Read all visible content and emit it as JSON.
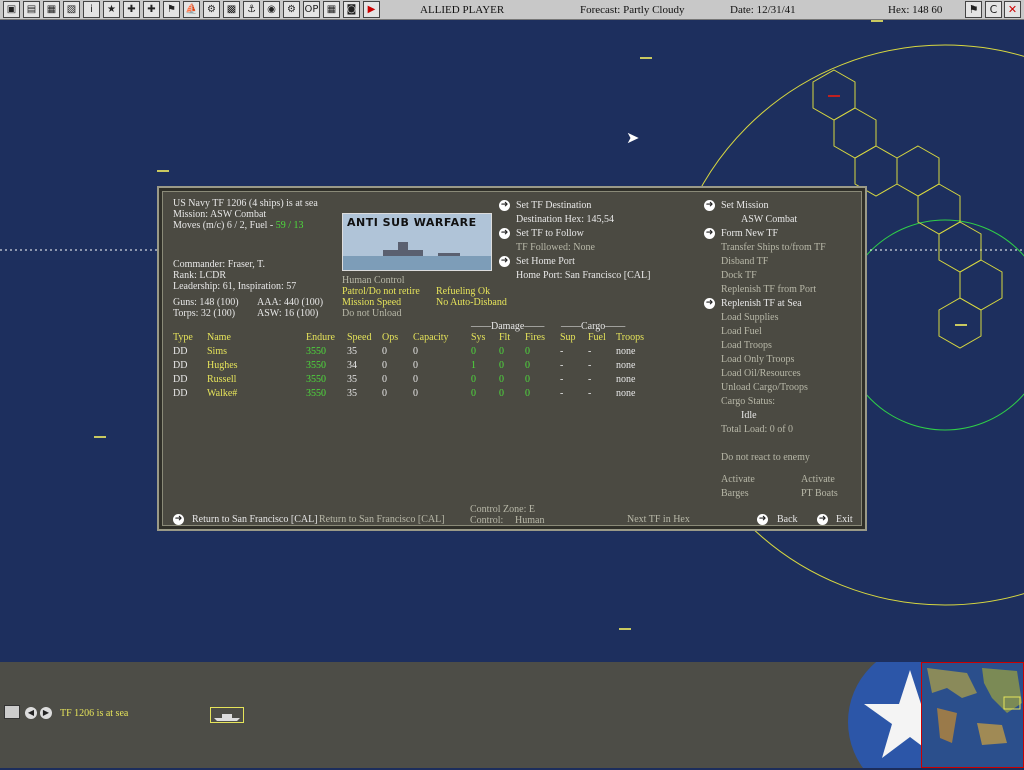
{
  "topbar": {
    "buttons": [
      "▣",
      "▤",
      "▦",
      "▧",
      "i",
      "★",
      "✚",
      "✚",
      "⚑",
      "⛵",
      "⚙",
      "▩",
      "⚓",
      "◉",
      "⚙",
      "OP",
      "▦",
      "◙",
      "▶"
    ],
    "player": "ALLIED PLAYER",
    "forecast": "Forecast: Partly Cloudy",
    "date": "Date: 12/31/41",
    "hex": "Hex: 148 60",
    "right_buttons": [
      "⚑",
      "C",
      "✕"
    ]
  },
  "panel": {
    "header": {
      "line1": "US Navy TF 1206 (4 ships) is at sea",
      "line2": "Mission:  ASW Combat",
      "line3_prefix": "Moves (m/c) 6 / 2, Fuel - ",
      "line3_fuel": "59 / 13"
    },
    "commander": {
      "name": "Commander: Fraser, T.",
      "rank": "Rank: LCDR",
      "leadership": "Leadership: 61, Inspiration: 57"
    },
    "stats": {
      "guns": "Guns: 148 (100)",
      "aaa": "AAA: 440 (100)",
      "torps": "Torps: 32 (100)",
      "asw": "ASW: 16 (100)"
    },
    "badge_title": "ANTI SUB WARFARE",
    "control": {
      "human_control": "Human Control",
      "patrol": "Patrol/Do not retire",
      "mission_speed": "Mission Speed",
      "unload": "Do not Unload",
      "refueling": "Refueling Ok",
      "auto_disband": "No Auto-Disband"
    },
    "destination": {
      "set_dest": "Set TF Destination",
      "dest_hex": "Destination Hex: 145,54",
      "set_follow": "Set TF to Follow",
      "followed": "TF Followed: None",
      "set_home": "Set Home Port",
      "home_port": "Home Port: San Francisco [CAL]"
    },
    "table": {
      "group_damage": "Damage",
      "group_cargo": "Cargo",
      "headers": [
        "Type",
        "Name",
        "Endure",
        "Speed",
        "Ops",
        "Capacity",
        "Sys",
        "Flt",
        "Fires",
        "Sup",
        "Fuel",
        "Troops"
      ],
      "rows": [
        {
          "type": "DD",
          "name": "Sims",
          "endure": "3550",
          "speed": "35",
          "ops": "0",
          "capacity": "0",
          "sys": "0",
          "flt": "0",
          "fires": "0",
          "sup": "-",
          "fuel": "-",
          "troops": "none"
        },
        {
          "type": "DD",
          "name": "Hughes",
          "endure": "3550",
          "speed": "34",
          "ops": "0",
          "capacity": "0",
          "sys": "1",
          "flt": "0",
          "fires": "0",
          "sup": "-",
          "fuel": "-",
          "troops": "none"
        },
        {
          "type": "DD",
          "name": "Russell",
          "endure": "3550",
          "speed": "35",
          "ops": "0",
          "capacity": "0",
          "sys": "0",
          "flt": "0",
          "fires": "0",
          "sup": "-",
          "fuel": "-",
          "troops": "none"
        },
        {
          "type": "DD",
          "name": "Walke#",
          "endure": "3550",
          "speed": "35",
          "ops": "0",
          "capacity": "0",
          "sys": "0",
          "flt": "0",
          "fires": "0",
          "sup": "-",
          "fuel": "-",
          "troops": "none"
        }
      ]
    },
    "menu": {
      "set_mission": "Set Mission",
      "mission_value": "ASW Combat",
      "form_new_tf": "Form New TF",
      "transfer": "Transfer Ships to/from TF",
      "disband": "Disband TF",
      "dock": "Dock TF",
      "replenish_port": "Replenish TF from Port",
      "replenish_sea": "Replenish TF at Sea",
      "load_supplies": "Load Supplies",
      "load_fuel": "Load Fuel",
      "load_troops": "Load Troops",
      "load_only_troops": "Load Only Troops",
      "load_oil": "Load Oil/Resources",
      "unload_cargo": "Unload Cargo/Troops",
      "cargo_status": "Cargo Status:",
      "cargo_status_value": "Idle",
      "total_load": "Total Load: 0 of 0",
      "react": "Do not react to enemy",
      "activate_barges_1": "Activate",
      "activate_barges_2": "Barges",
      "activate_pt_1": "Activate",
      "activate_pt_2": "PT Boats"
    },
    "footer": {
      "return_to": "Return to San Francisco [CAL]",
      "return_to_2": "Return to San Francisco [CAL]",
      "control_zone": "Control Zone: E",
      "control_label": "Control:",
      "control_value": "Human",
      "next_tf": "Next TF in Hex",
      "back": "Back",
      "exit": "Exit"
    }
  },
  "bottombar": {
    "status": "TF 1206 is at sea"
  }
}
